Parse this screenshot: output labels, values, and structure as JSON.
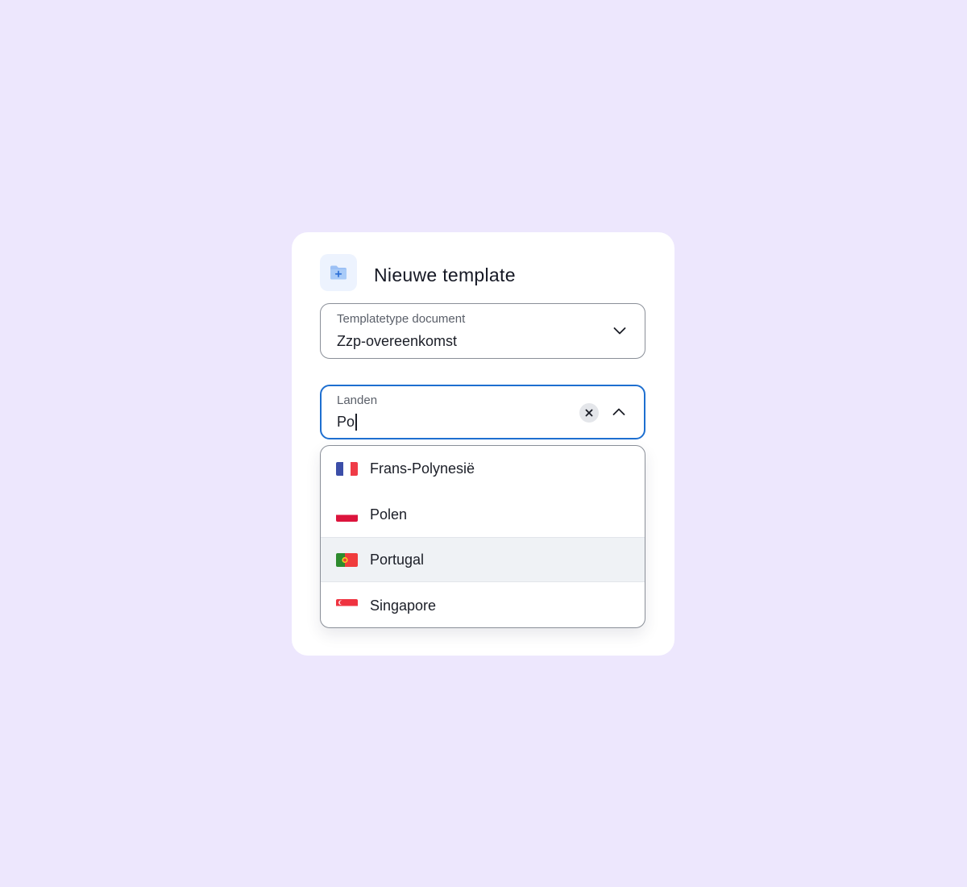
{
  "dialog": {
    "title": "Nieuwe template",
    "icon": "folder-plus-icon",
    "accent_color": "#1e6fd0"
  },
  "template_type_field": {
    "label": "Templatetype document",
    "value": "Zzp-overeenkomst",
    "icon": "chevron-down-icon"
  },
  "countries_field": {
    "label": "Landen",
    "value": "Po",
    "clear_icon": "close-icon",
    "toggle_icon": "chevron-up-icon"
  },
  "dropdown": {
    "options": [
      {
        "label": "Frans-Polynesië",
        "flag": "france-flag-icon",
        "highlighted": false
      },
      {
        "label": "Polen",
        "flag": "poland-flag-icon",
        "highlighted": false
      },
      {
        "label": "Portugal",
        "flag": "portugal-flag-icon",
        "highlighted": true
      },
      {
        "label": "Singapore",
        "flag": "singapore-flag-icon",
        "highlighted": false
      }
    ]
  }
}
